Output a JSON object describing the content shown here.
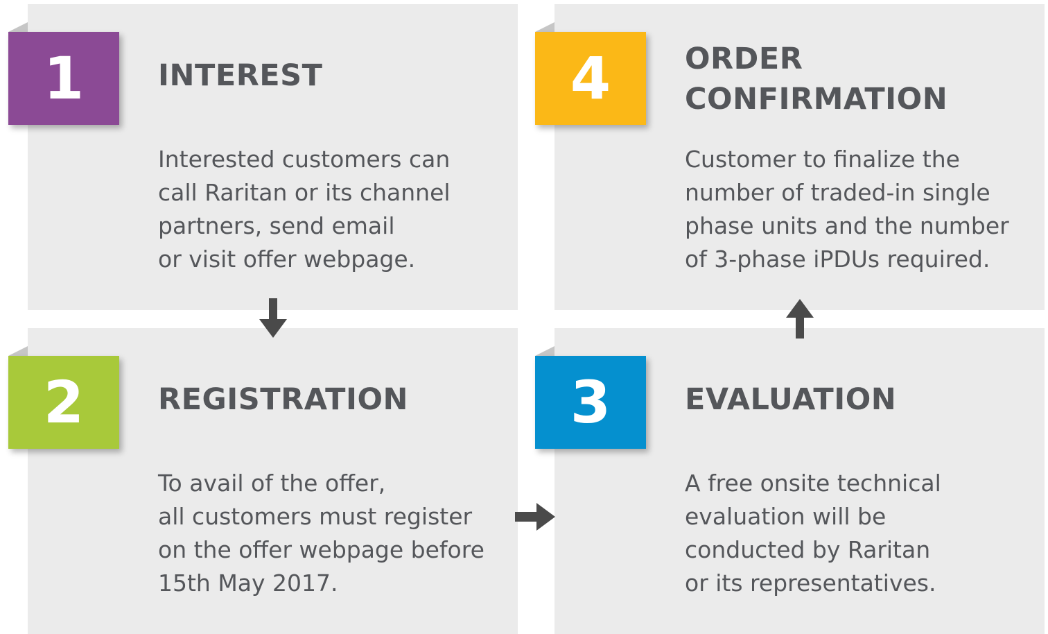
{
  "colors": {
    "panel_background": "#ebebeb",
    "text": "#54565a",
    "arrow": "#4a4a4a",
    "step1": "#8b4a95",
    "step2": "#a8c93a",
    "step3": "#0590cf",
    "step4": "#fbb817"
  },
  "steps": [
    {
      "number": "1",
      "title_lines": [
        "INTEREST"
      ],
      "description_lines": [
        "Interested customers can",
        "call Raritan or its channel",
        "partners, send email",
        "or visit offer webpage."
      ]
    },
    {
      "number": "2",
      "title_lines": [
        "REGISTRATION"
      ],
      "description_lines": [
        "To avail of the offer,",
        "all customers must register",
        "on the offer webpage before",
        "15th May 2017."
      ]
    },
    {
      "number": "3",
      "title_lines": [
        "EVALUATION"
      ],
      "description_lines": [
        "A free onsite technical",
        "evaluation will be",
        "conducted by Raritan",
        "or its representatives."
      ]
    },
    {
      "number": "4",
      "title_lines": [
        "ORDER",
        "CONFIRMATION"
      ],
      "description_lines": [
        "Customer to finalize the",
        "number of traded-in single",
        "phase units and the number",
        "of 3-phase iPDUs required."
      ]
    }
  ],
  "arrows": [
    {
      "from": "1",
      "to": "2",
      "direction": "down",
      "icon": "arrow-down-icon"
    },
    {
      "from": "2",
      "to": "3",
      "direction": "right",
      "icon": "arrow-right-icon"
    },
    {
      "from": "3",
      "to": "4",
      "direction": "up",
      "icon": "arrow-up-icon"
    }
  ]
}
